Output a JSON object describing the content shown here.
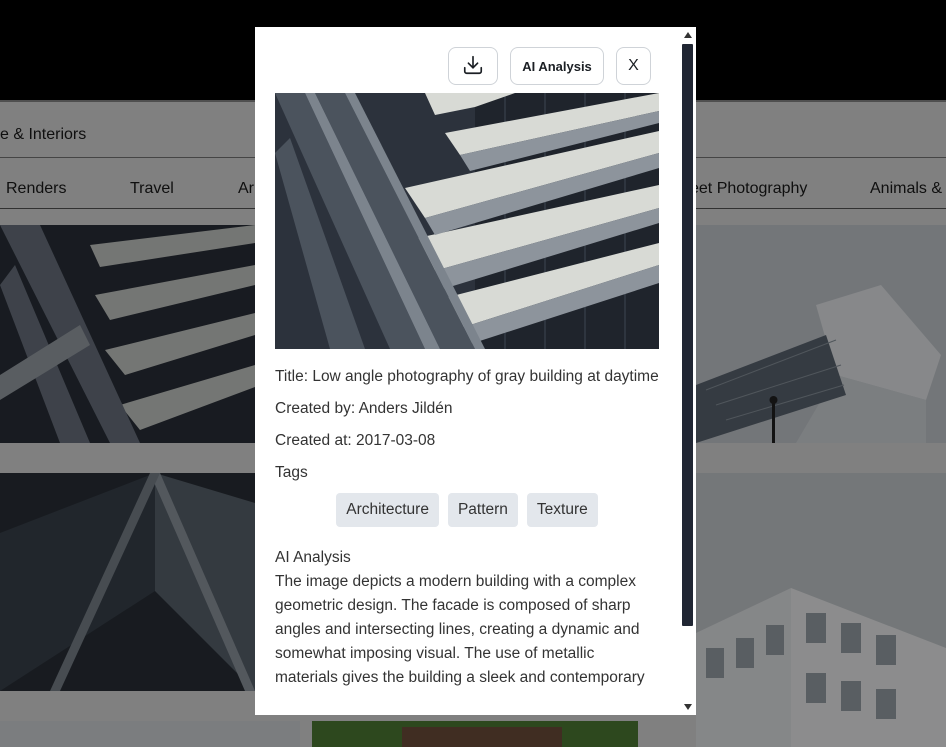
{
  "background": {
    "category_label": "e & Interiors",
    "nav_items": [
      "Renders",
      "Travel",
      "Ar",
      "eet Photography",
      "Animals &"
    ]
  },
  "modal": {
    "toolbar": {
      "download_icon": "download-icon",
      "ai_analysis_label": "AI Analysis",
      "close_label": "X"
    },
    "photo": {
      "title": "Title: Low angle photography of gray building at daytime",
      "created_by": "Created by: Anders Jildén",
      "created_at": "Created at: 2017-03-08",
      "tags_heading": "Tags",
      "tags": [
        "Architecture",
        "Pattern",
        "Texture"
      ]
    },
    "ai": {
      "heading": "AI Analysis",
      "text": "The image depicts a modern building with a complex geometric design. The facade is composed of sharp angles and intersecting lines, creating a dynamic and somewhat imposing visual. The use of metallic materials gives the building a sleek and contemporary"
    }
  },
  "colors": {
    "scrollbar_thumb": "#202633",
    "tag_bg": "#e3e7ec",
    "overlay": "rgba(0,0,0,0.42)"
  }
}
